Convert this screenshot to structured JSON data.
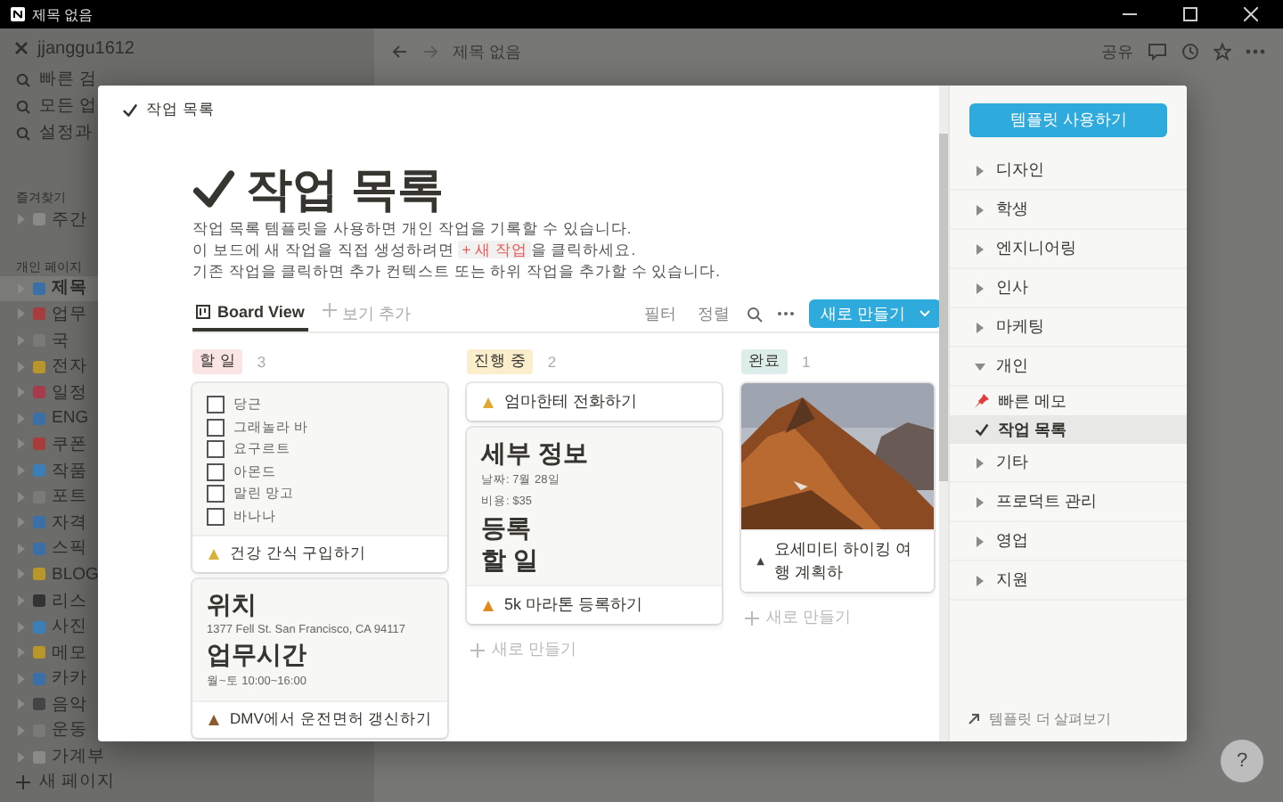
{
  "window": {
    "title": "제목 없음"
  },
  "sidebar": {
    "workspace": "jjanggu1612",
    "quick": [
      {
        "label": "빠른 검"
      },
      {
        "label": "모든 업"
      },
      {
        "label": "설정과"
      }
    ],
    "sections": [
      {
        "title": "즐겨찾기",
        "items": [
          {
            "label": "주간",
            "selected": false
          }
        ]
      },
      {
        "title": "개인 페이지",
        "items": [
          {
            "label": "제목",
            "selected": true
          },
          {
            "label": "업무",
            "selected": false
          },
          {
            "label": "국",
            "selected": false
          },
          {
            "label": "전자",
            "selected": false
          },
          {
            "label": "일정",
            "selected": false
          },
          {
            "label": "ENG",
            "selected": false
          },
          {
            "label": "쿠폰",
            "selected": false
          },
          {
            "label": "작품",
            "selected": false
          },
          {
            "label": "포트",
            "selected": false
          },
          {
            "label": "자격",
            "selected": false
          },
          {
            "label": "스픽",
            "selected": false
          },
          {
            "label": "BLOG",
            "selected": false
          },
          {
            "label": "리스",
            "selected": false
          },
          {
            "label": "사진",
            "selected": false
          },
          {
            "label": "메모",
            "selected": false
          },
          {
            "label": "카카",
            "selected": false
          },
          {
            "label": "음악",
            "selected": false
          },
          {
            "label": "운동",
            "selected": false
          },
          {
            "label": "가계부",
            "selected": false
          }
        ]
      }
    ],
    "new_page": "새 페이지"
  },
  "topbar": {
    "page_title": "제목 없음",
    "share": "공유"
  },
  "modal": {
    "breadcrumb": "작업 목록",
    "title": "작업 목록",
    "description": [
      {
        "kind": "plain",
        "text": "작업 목록 템플릿을 사용하면 개인 작업을 기록할 수 있습니다."
      },
      {
        "kind": "code",
        "before": "이 보드에 새 작업을 직접 생성하려면",
        "code": "+ 새 작업",
        "after": "을 클릭하세요."
      },
      {
        "kind": "plain",
        "text": "기존 작업을 클릭하면 추가 컨텍스트 또는 하위 작업을 추가할 수 있습니다."
      }
    ],
    "views": [
      {
        "label": "Board View",
        "selected": true
      }
    ],
    "add_view": "보기 추가",
    "filter": "필터",
    "sort": "정렬",
    "new_button": "새로 만들기",
    "columns": [
      {
        "name": "할 일",
        "color": "#fbe4e4",
        "count": "3",
        "cards": [
          {
            "blocks": [
              {
                "kind": "check",
                "text": "당근",
                "checked": false
              },
              {
                "kind": "check",
                "text": "그래놀라 바",
                "checked": false
              },
              {
                "kind": "check",
                "text": "요구르트",
                "checked": false
              },
              {
                "kind": "check",
                "text": "아몬드",
                "checked": false
              },
              {
                "kind": "check",
                "text": "말린 망고",
                "checked": false
              },
              {
                "kind": "check",
                "text": "바나나",
                "checked": false
              }
            ],
            "title": "건강 간식 구입하기"
          },
          {
            "blocks": [
              {
                "kind": "heading",
                "text": "위치"
              },
              {
                "kind": "text",
                "text": "1377 Fell St. San Francisco, CA 94117"
              },
              {
                "kind": "heading",
                "text": "업무시간"
              },
              {
                "kind": "text",
                "text": "월~토 10:00~16:00"
              }
            ],
            "title": "DMV에서 운전면허 갱신하기"
          }
        ]
      },
      {
        "name": "진행 중",
        "color": "#fbeecc",
        "count": "2",
        "new": "새로 만들기",
        "cards": [
          {
            "title": "엄마한테 전화하기"
          },
          {
            "blocks": [
              {
                "kind": "heading",
                "text": "세부 정보"
              },
              {
                "kind": "text",
                "text": "날짜: 7월 28일"
              },
              {
                "kind": "text",
                "text": "비용: $35"
              },
              {
                "kind": "heading",
                "text": "등록"
              },
              {
                "kind": "heading",
                "text": "할 일"
              }
            ],
            "title": "5k 마라톤 등록하기"
          }
        ]
      },
      {
        "name": "완료",
        "color": "#ddedea",
        "count": "1",
        "new": "새로 만들기",
        "cards": [
          {
            "title": "요세미티 하이킹 여행 계획하"
          }
        ]
      }
    ],
    "panel": {
      "use_button": "템플릿 사용하기",
      "categories": [
        {
          "label": "디자인",
          "expanded": false
        },
        {
          "label": "학생",
          "expanded": false
        },
        {
          "label": "엔지니어링",
          "expanded": false
        },
        {
          "label": "인사",
          "expanded": false
        },
        {
          "label": "마케팅",
          "expanded": false
        },
        {
          "label": "개인",
          "expanded": true,
          "children": [
            {
              "label": "빠른 메모",
              "kind": "pin",
              "selected": false
            },
            {
              "label": "작업 목록",
              "kind": "check",
              "selected": true
            }
          ]
        },
        {
          "label": "기타",
          "expanded": false
        },
        {
          "label": "프로덕트 관리",
          "expanded": false
        },
        {
          "label": "영업",
          "expanded": false
        },
        {
          "label": "지원",
          "expanded": false
        }
      ],
      "more": "템플릿 더 살펴보기"
    }
  },
  "help": "?"
}
